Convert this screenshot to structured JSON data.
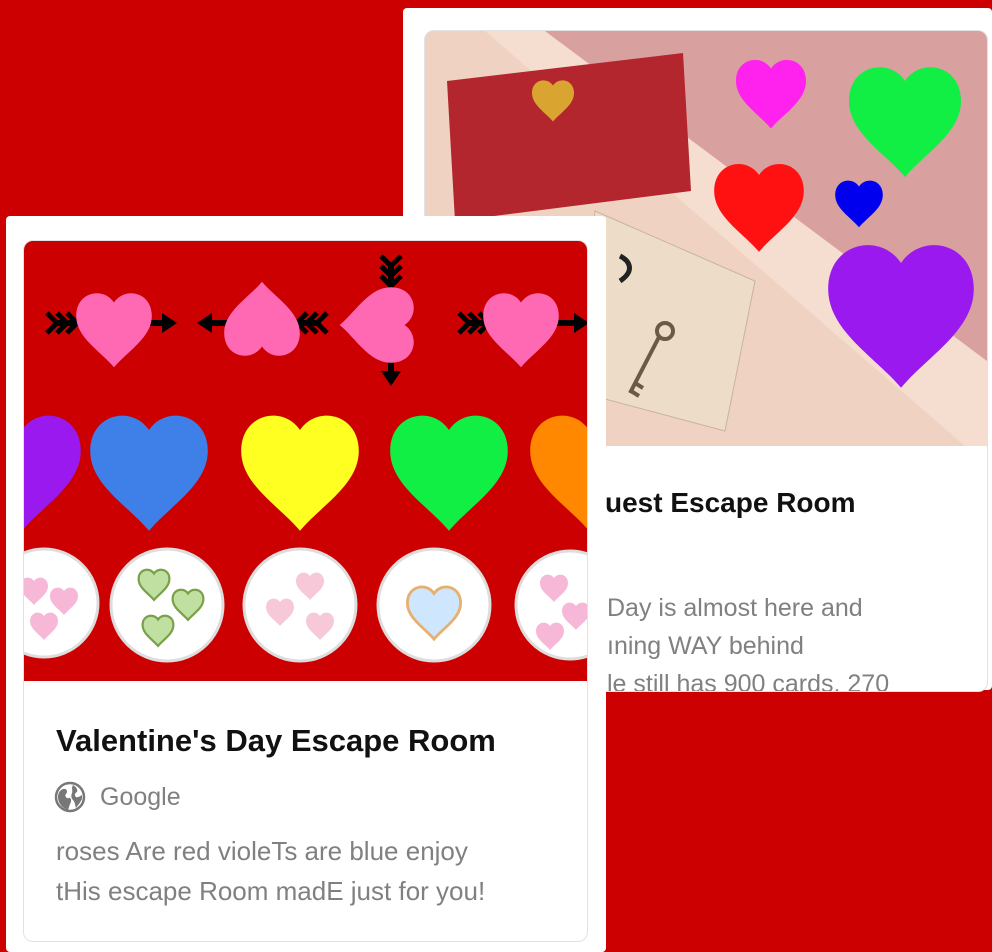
{
  "back_card": {
    "title": "uest Escape Room",
    "description_lines": [
      "Day is almost here and",
      "ıning WAY behind",
      "le still has 900 cards, 270"
    ]
  },
  "front_card": {
    "title": "Valentine's Day Escape Room",
    "source": {
      "label": "Google",
      "icon": "globe-icon"
    },
    "description_lines": [
      "roses Are red violeTs are blue enjoy",
      "tHis escape Room madE just for you!"
    ]
  },
  "colors": {
    "background": "#cc0000",
    "heart_pink": "#ff69b4",
    "heart_blue": "#3f7fe8",
    "heart_yellow": "#ffff22",
    "heart_green": "#11ee44",
    "heart_orange": "#ff8800",
    "heart_purple": "#9a19ee",
    "heart_magenta": "#ff22ee",
    "heart_red": "#ff1111",
    "heart_dark_blue": "#0000ee"
  }
}
